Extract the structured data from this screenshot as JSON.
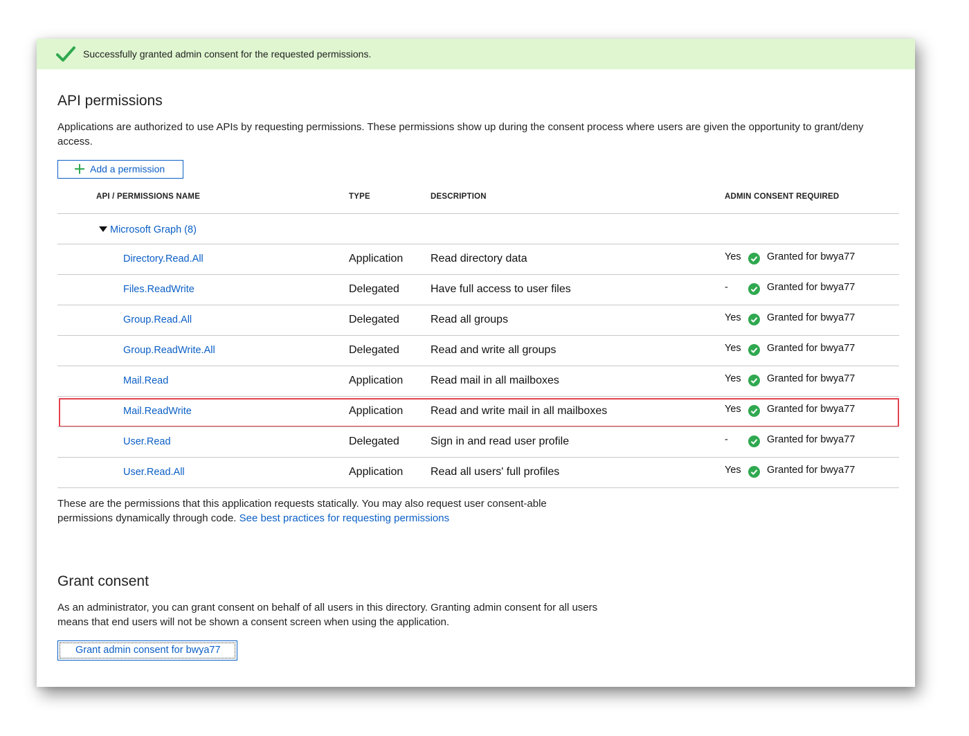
{
  "banner": {
    "message": "Successfully granted admin consent for the requested permissions."
  },
  "api_permissions": {
    "title": "API permissions",
    "description": "Applications are authorized to use APIs by requesting permissions. These permissions show up during the consent process where users are given the opportunity to grant/deny access.",
    "add_button_label": "Add a permission",
    "columns": {
      "name": "API / PERMISSIONS NAME",
      "type": "TYPE",
      "description": "DESCRIPTION",
      "admin_consent": "ADMIN CONSENT REQUIRED"
    },
    "group_label": "Microsoft Graph (8)",
    "rows": [
      {
        "name": "Directory.Read.All",
        "type": "Application",
        "description": "Read directory data",
        "admin_consent": "Yes",
        "status": "Granted for bwya77"
      },
      {
        "name": "Files.ReadWrite",
        "type": "Delegated",
        "description": "Have full access to user files",
        "admin_consent": "-",
        "status": "Granted for bwya77"
      },
      {
        "name": "Group.Read.All",
        "type": "Delegated",
        "description": "Read all groups",
        "admin_consent": "Yes",
        "status": "Granted for bwya77"
      },
      {
        "name": "Group.ReadWrite.All",
        "type": "Delegated",
        "description": "Read and write all groups",
        "admin_consent": "Yes",
        "status": "Granted for bwya77"
      },
      {
        "name": "Mail.Read",
        "type": "Application",
        "description": "Read mail in all mailboxes",
        "admin_consent": "Yes",
        "status": "Granted for bwya77"
      },
      {
        "name": "Mail.ReadWrite",
        "type": "Application",
        "description": "Read and write mail in all mailboxes",
        "admin_consent": "Yes",
        "status": "Granted for bwya77"
      },
      {
        "name": "User.Read",
        "type": "Delegated",
        "description": "Sign in and read user profile",
        "admin_consent": "-",
        "status": "Granted for bwya77"
      },
      {
        "name": "User.Read.All",
        "type": "Application",
        "description": "Read all users' full profiles",
        "admin_consent": "Yes",
        "status": "Granted for bwya77"
      }
    ],
    "footer_text": "These are the permissions that this application requests statically. You may also request user consent-able permissions dynamically through code.",
    "footer_link": "See best practices for requesting permissions"
  },
  "grant_consent": {
    "title": "Grant consent",
    "description": "As an administrator, you can grant consent on behalf of all users in this directory. Granting admin consent for all users means that end users will not be shown a consent screen when using the application.",
    "button_label": "Grant admin consent for bwya77"
  },
  "colors": {
    "link": "#0b5fc6",
    "success": "#2fa84f",
    "banner_bg": "#dff6d0",
    "highlight": "#e2434f"
  },
  "icons": {
    "banner": "checkmark-icon",
    "add": "plus-icon",
    "status": "check-circle-icon",
    "expand": "triangle-down-icon"
  }
}
